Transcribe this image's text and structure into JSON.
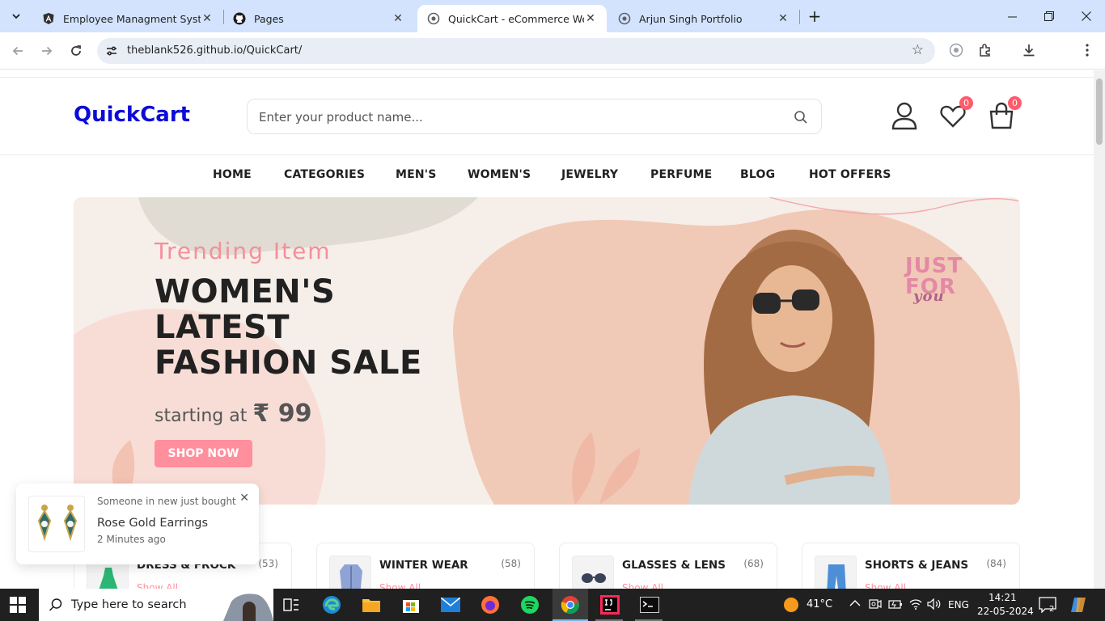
{
  "browser": {
    "tabs": [
      {
        "title": "Employee Managment System",
        "favicon": "angular-icon",
        "active": false
      },
      {
        "title": "Pages",
        "favicon": "github-icon",
        "active": false
      },
      {
        "title": "QuickCart - eCommerce Websit",
        "favicon": "globe-icon",
        "active": true
      },
      {
        "title": "Arjun Singh Portfolio",
        "favicon": "globe-icon",
        "active": false
      }
    ],
    "url": "theblank526.github.io/QuickCart/"
  },
  "site": {
    "logo": "QuickCart",
    "search_placeholder": "Enter your product name...",
    "wishlist_count": "0",
    "cart_count": "0",
    "menu": [
      "HOME",
      "CATEGORIES",
      "MEN'S",
      "WOMEN'S",
      "JEWELRY",
      "PERFUME",
      "BLOG",
      "HOT OFFERS"
    ]
  },
  "banner": {
    "subtitle": "Trending Item",
    "title_line1": "WOMEN'S",
    "title_line2": "LATEST",
    "title_line3": "FASHION SALE",
    "price_prefix": "starting at",
    "price": "₹ 99",
    "button": "SHOP NOW",
    "tag_line1": "JUST",
    "tag_line2": "FOR",
    "tag_line3": "you"
  },
  "categories": [
    {
      "name": "DRESS & FROCK",
      "count": "(53)",
      "link": "Show All"
    },
    {
      "name": "WINTER WEAR",
      "count": "(58)",
      "link": "Show All"
    },
    {
      "name": "GLASSES & LENS",
      "count": "(68)",
      "link": "Show All"
    },
    {
      "name": "SHORTS & JEANS",
      "count": "(84)",
      "link": "Show All"
    }
  ],
  "toast": {
    "message": "Someone in new just bought",
    "product": "Rose Gold Earrings",
    "time": "2 Minutes ago"
  },
  "taskbar": {
    "search_placeholder": "Type here to search",
    "weather": "41°C",
    "language": "ENG",
    "time": "14:21",
    "date": "22-05-2024",
    "notifications": "2"
  }
}
